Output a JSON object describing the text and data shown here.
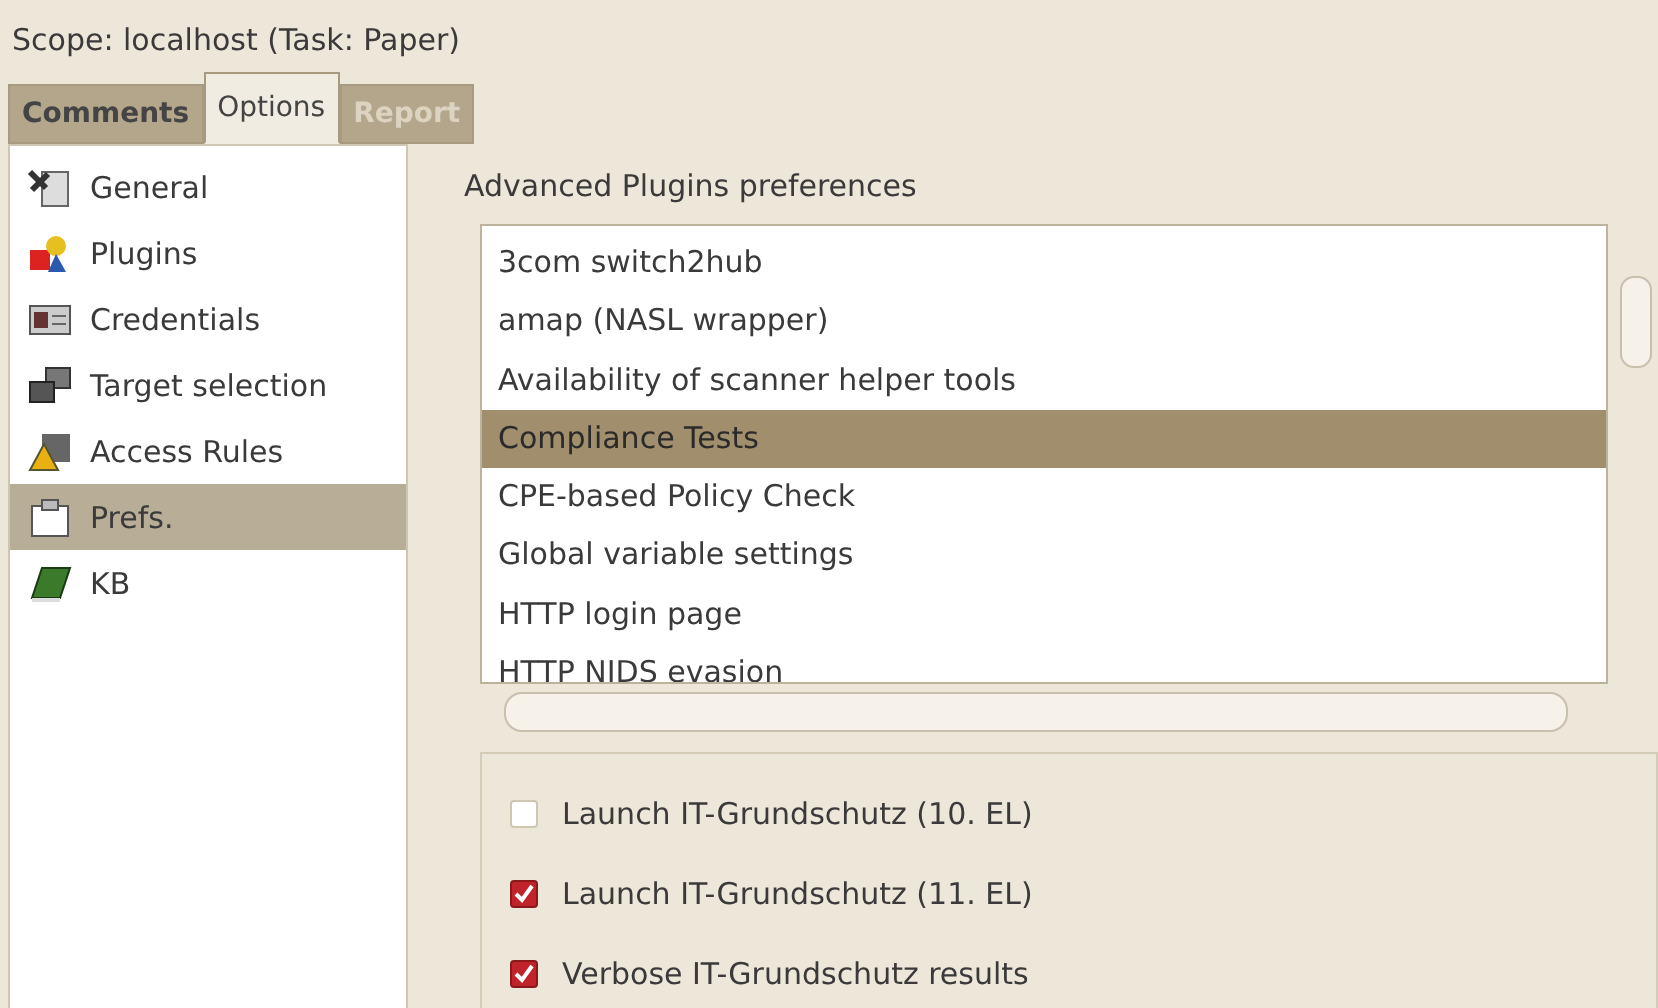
{
  "scope_title": "Scope: localhost (Task: Paper)",
  "tabs": [
    {
      "label": "Comments",
      "selected": false,
      "disabled": false
    },
    {
      "label": "Options",
      "selected": true,
      "disabled": false
    },
    {
      "label": "Report",
      "selected": false,
      "disabled": true
    }
  ],
  "sidebar": {
    "items": [
      {
        "label": "General",
        "selected": false
      },
      {
        "label": "Plugins",
        "selected": false
      },
      {
        "label": "Credentials",
        "selected": false
      },
      {
        "label": "Target selection",
        "selected": false
      },
      {
        "label": "Access Rules",
        "selected": false
      },
      {
        "label": "Prefs.",
        "selected": true
      },
      {
        "label": "KB",
        "selected": false
      }
    ]
  },
  "section_title": "Advanced Plugins preferences",
  "plugin_list": [
    {
      "label": "3com switch2hub",
      "selected": false
    },
    {
      "label": "amap (NASL wrapper)",
      "selected": false
    },
    {
      "label": "Availability of scanner helper tools",
      "selected": false
    },
    {
      "label": "Compliance Tests",
      "selected": true
    },
    {
      "label": "CPE-based Policy Check",
      "selected": false
    },
    {
      "label": "Global variable settings",
      "selected": false
    },
    {
      "label": "HTTP login page",
      "selected": false
    },
    {
      "label": "HTTP NIDS evasion",
      "selected": false
    }
  ],
  "options": [
    {
      "label": "Launch IT-Grundschutz (10. EL)",
      "checked": false
    },
    {
      "label": "Launch IT-Grundschutz (11. EL)",
      "checked": true
    },
    {
      "label": "Verbose IT-Grundschutz results",
      "checked": true
    }
  ]
}
